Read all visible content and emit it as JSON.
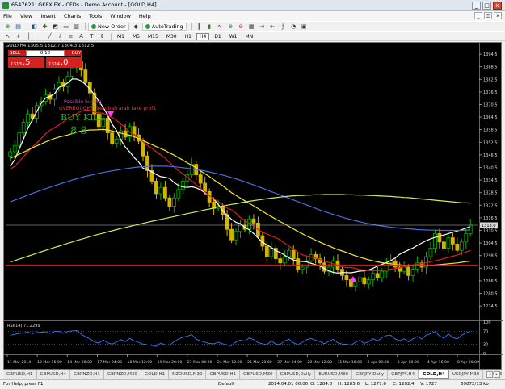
{
  "window": {
    "title": "6547621: GKFX FX - CFDs - Demo Account - [GOLD,H4]",
    "buttons": [
      "_",
      "□",
      "x"
    ]
  },
  "menu": {
    "items": [
      "File",
      "View",
      "Insert",
      "Charts",
      "Tools",
      "Window",
      "Help"
    ]
  },
  "toolbar": {
    "new_order": "New Order",
    "autotrading": "AutoTrading",
    "timeframes": [
      "M1",
      "M5",
      "M15",
      "M30",
      "H1",
      "H4",
      "D1",
      "W1",
      "MN"
    ],
    "active_timeframe": "H4"
  },
  "chart_window": {
    "title": "GOLD,H4  1305.5 1312.7 1304.3 1312.5"
  },
  "one_click": {
    "sell_label": "SELL",
    "buy_label": "BUY",
    "volume": "0.10",
    "sell_small": "1313",
    "sell_big": ".5",
    "buy_small": "1314",
    "buy_big": ".0"
  },
  "annotations": {
    "lines": [
      "Possible buying",
      "OVERBOUGHT! berubah arah take profit"
    ],
    "signal": "BUY KILL",
    "digits": "8  8"
  },
  "rsi": {
    "label": "RSI(14) 71.2299"
  },
  "chart_data": {
    "type": "candlestick",
    "symbol": "GOLD",
    "timeframe": "H4",
    "ylim": [
      1268,
      1398
    ],
    "price_ticks": [
      1394.5,
      1388.5,
      1382.5,
      1376.5,
      1370.5,
      1364.5,
      1358.5,
      1352.5,
      1346.5,
      1340.5,
      1334.5,
      1328.5,
      1322.5,
      1316.5,
      1310.5,
      1304.5,
      1298.5,
      1292.5,
      1286.5,
      1280.5,
      1274.5
    ],
    "current_price": "1313.0",
    "current_price_value": 1313.0,
    "horizontal_lines": [
      1313.0,
      1294.0
    ],
    "x_ticks": [
      "11 Mar 2014",
      "12 Mar 16:00",
      "14 Mar 00:00",
      "17 Mar 04:00",
      "18 Mar 12:00",
      "19 Mar 20:00",
      "21 Mar 04:00",
      "24 Mar 12:00",
      "25 Mar 20:00",
      "27 Mar 04:00",
      "28 Mar 12:00",
      "31 Mar 16:00",
      "2 Apr 00:00",
      "3 Apr 08:00",
      "4 Apr 16:00",
      "8 Apr 00:00"
    ],
    "close": [
      1348,
      1351,
      1357,
      1362,
      1366,
      1364,
      1370,
      1372,
      1375,
      1373,
      1378,
      1381,
      1379,
      1384,
      1388,
      1391,
      1387,
      1381,
      1376,
      1366,
      1360,
      1364,
      1357,
      1352,
      1354,
      1358,
      1355,
      1360,
      1356,
      1353,
      1346,
      1339,
      1334,
      1328,
      1331,
      1326,
      1322,
      1326,
      1330,
      1334,
      1337,
      1342,
      1337,
      1333,
      1329,
      1324,
      1321,
      1322,
      1318,
      1311,
      1306,
      1310,
      1313,
      1311,
      1316,
      1314,
      1308,
      1303,
      1298,
      1302,
      1297,
      1295,
      1298,
      1301,
      1297,
      1292,
      1293,
      1296,
      1299,
      1297,
      1295,
      1291,
      1293,
      1296,
      1292,
      1289,
      1287,
      1284,
      1286,
      1288,
      1285,
      1287,
      1290,
      1288,
      1291,
      1295,
      1296,
      1293,
      1291,
      1293,
      1289,
      1292,
      1295,
      1293,
      1298,
      1302,
      1309,
      1305,
      1302,
      1307,
      1304,
      1301,
      1305,
      1309,
      1313
    ],
    "series": [
      {
        "name": "white",
        "color": "#ffffff",
        "values": [
          1341.0,
          1344.2,
          1349.2,
          1354.2,
          1359.2,
          1363.2,
          1367.2,
          1371.1,
          1373.6,
          1374.4,
          1375.7,
          1378.7,
          1379.6,
          1380.8,
          1382.7,
          1382.6,
          1381.8,
          1380.1,
          1377.9,
          1375.2,
          1372.1,
          1369.1,
          1365.5,
          1361.1,
          1358.1,
          1353.6,
          1350.2,
          1347.9,
          1345.2,
          1343.2,
          1340.1,
          1339.5,
          1338.4,
          1337.1,
          1336.1,
          1335.8,
          1335.3,
          1333.3,
          1332.0,
          1331.2,
          1331.0,
          1331.3,
          1330.8,
          1329.8,
          1328.4,
          1327.0,
          1325.4,
          1322.9,
          1320.0,
          1317.6,
          1315.8,
          1314.4,
          1313.7,
          1312.0,
          1310.8,
          1309.0,
          1306.9,
          1304.8,
          1303.6,
          1302.4,
          1300.9,
          1300.0,
          1298.7,
          1297.4,
          1296.4,
          1295.9,
          1295.7,
          1295.5,
          1294.8,
          1294.2,
          1293.5,
          1292.3,
          1291.2,
          1290.5,
          1290.2,
          1290.4,
          1290.4,
          1290.3,
          1290.7,
          1291.1,
          1291.2,
          1291.6,
          1292.5,
          1293.5,
          1294.3,
          1295.1,
          1296.1,
          1297.4,
          1299.1,
          1300.2,
          1301.2,
          1302.1,
          1303.4,
          1304.5,
          1305.6,
          1306.5,
          1307.2,
          1307.8,
          1308.3,
          1309.0,
          1309.6,
          1310.2,
          1310.8,
          1311.6,
          1312.3
        ]
      },
      {
        "name": "red",
        "color": "#dd1e1e",
        "values": [
          1339.8,
          1341.0,
          1343.3,
          1345.7,
          1348.1,
          1350.3,
          1352.2,
          1354.4,
          1356.6,
          1358.3,
          1359.5,
          1360.8,
          1362.2,
          1363.8,
          1364.9,
          1366.1,
          1367.3,
          1367.8,
          1367.8,
          1366.9,
          1366.5,
          1366.4,
          1365.4,
          1364.3,
          1363.0,
          1361.1,
          1359.5,
          1357.4,
          1356.2,
          1354.6,
          1352.8,
          1350.9,
          1349.6,
          1348.0,
          1346.5,
          1345.0,
          1342.9,
          1340.8,
          1338.9,
          1337.5,
          1335.8,
          1334.1,
          1332.3,
          1330.6,
          1328.8,
          1327.0,
          1325.5,
          1324.3,
          1322.6,
          1321.2,
          1320.3,
          1318.7,
          1316.6,
          1315.2,
          1313.9,
          1312.5,
          1311.0,
          1309.6,
          1308.8,
          1307.9,
          1307.0,
          1306.0,
          1304.4,
          1303.0,
          1301.6,
          1300.2,
          1298.9,
          1298.3,
          1297.8,
          1297.3,
          1296.6,
          1295.8,
          1295.2,
          1294.6,
          1293.9,
          1293.1,
          1292.8,
          1292.8,
          1292.4,
          1291.8,
          1291.6,
          1291.3,
          1291.3,
          1291.3,
          1291.3,
          1291.6,
          1292.0,
          1292.3,
          1292.6,
          1293.1,
          1293.6,
          1294.0,
          1294.4,
          1294.7,
          1295.1,
          1295.6,
          1296.0,
          1296.5,
          1297.1,
          1297.6,
          1298.2,
          1298.8,
          1299.5,
          1300.2,
          1301.0
        ]
      },
      {
        "name": "yellow",
        "color": "#f2e830",
        "values": [
          1344.9,
          1345.8,
          1346.8,
          1347.8,
          1348.8,
          1349.9,
          1350.8,
          1351.7,
          1352.7,
          1353.5,
          1354.3,
          1355.0,
          1355.5,
          1356.0,
          1356.6,
          1357.3,
          1357.8,
          1358.1,
          1358.4,
          1358.4,
          1358.5,
          1358.6,
          1358.4,
          1357.9,
          1357.4,
          1356.9,
          1356.3,
          1355.9,
          1355.1,
          1354.4,
          1353.4,
          1352.3,
          1351.4,
          1350.4,
          1349.5,
          1348.6,
          1347.4,
          1346.4,
          1345.2,
          1344.0,
          1342.7,
          1341.6,
          1340.3,
          1338.8,
          1337.5,
          1336.1,
          1334.6,
          1333.2,
          1331.8,
          1330.1,
          1328.5,
          1327.2,
          1325.9,
          1324.6,
          1323.4,
          1322.2,
          1320.9,
          1319.6,
          1318.3,
          1317.1,
          1315.9,
          1314.7,
          1313.6,
          1312.4,
          1311.2,
          1310.0,
          1308.9,
          1307.8,
          1306.9,
          1305.9,
          1304.9,
          1304.0,
          1303.1,
          1302.2,
          1301.4,
          1300.7,
          1300.0,
          1299.2,
          1298.4,
          1297.7,
          1297.1,
          1296.5,
          1296.0,
          1295.5,
          1295.1,
          1294.8,
          1294.6,
          1294.3,
          1294.1,
          1293.9,
          1293.8,
          1293.7,
          1293.7,
          1293.7,
          1293.7,
          1293.8,
          1294.0,
          1294.2,
          1294.4,
          1294.6,
          1294.8,
          1295.0,
          1295.3,
          1295.6,
          1295.9
        ]
      },
      {
        "name": "blue",
        "color": "#4a6fe0",
        "values": [
          1324.1,
          1324.9,
          1325.7,
          1326.5,
          1327.4,
          1328.1,
          1328.9,
          1329.7,
          1330.4,
          1331.1,
          1331.8,
          1332.5,
          1333.2,
          1333.8,
          1334.5,
          1335.1,
          1335.7,
          1336.3,
          1336.7,
          1337.2,
          1337.7,
          1338.1,
          1338.5,
          1338.9,
          1339.2,
          1339.6,
          1339.9,
          1340.2,
          1340.5,
          1340.7,
          1340.8,
          1341.0,
          1341.1,
          1341.1,
          1341.1,
          1341.1,
          1341.0,
          1340.8,
          1340.6,
          1340.4,
          1340.1,
          1339.8,
          1339.5,
          1339.2,
          1338.8,
          1338.4,
          1337.9,
          1337.4,
          1336.9,
          1336.3,
          1335.7,
          1335.1,
          1334.4,
          1333.7,
          1332.9,
          1332.2,
          1331.4,
          1330.6,
          1329.8,
          1329.0,
          1328.2,
          1327.4,
          1326.6,
          1325.8,
          1325.0,
          1324.2,
          1323.4,
          1322.6,
          1321.8,
          1321.0,
          1320.2,
          1319.5,
          1318.8,
          1318.1,
          1317.5,
          1316.8,
          1316.2,
          1315.7,
          1315.1,
          1314.6,
          1314.1,
          1313.7,
          1313.3,
          1312.9,
          1312.6,
          1312.3,
          1312.0,
          1311.8,
          1311.6,
          1311.4,
          1311.2,
          1311.1,
          1310.9,
          1310.8,
          1310.7,
          1310.6,
          1310.6,
          1310.5,
          1310.5,
          1310.5,
          1310.5,
          1310.5,
          1310.5,
          1310.6,
          1310.7
        ]
      },
      {
        "name": "green",
        "color": "#c8f05a",
        "values": [
          1295.4,
          1296.1,
          1296.8,
          1297.5,
          1298.2,
          1298.9,
          1299.6,
          1300.3,
          1301.0,
          1301.7,
          1302.4,
          1303.0,
          1303.7,
          1304.4,
          1305.0,
          1305.7,
          1306.3,
          1306.9,
          1307.5,
          1308.1,
          1308.7,
          1309.2,
          1309.8,
          1310.3,
          1310.9,
          1311.4,
          1311.9,
          1312.4,
          1312.9,
          1313.4,
          1313.9,
          1314.4,
          1314.9,
          1315.3,
          1315.8,
          1316.2,
          1316.7,
          1317.1,
          1317.6,
          1318.0,
          1318.5,
          1318.9,
          1319.4,
          1319.8,
          1320.3,
          1320.7,
          1321.2,
          1321.6,
          1322.1,
          1322.5,
          1322.9,
          1323.2,
          1323.6,
          1324.0,
          1324.4,
          1324.7,
          1325.0,
          1325.3,
          1325.6,
          1325.9,
          1326.1,
          1326.4,
          1326.6,
          1326.8,
          1327.0,
          1327.1,
          1327.2,
          1327.3,
          1327.4,
          1327.5,
          1327.5,
          1327.6,
          1327.6,
          1327.6,
          1327.6,
          1327.6,
          1327.5,
          1327.5,
          1327.4,
          1327.4,
          1327.3,
          1327.2,
          1327.1,
          1327.0,
          1326.9,
          1326.8,
          1326.7,
          1326.5,
          1326.4,
          1326.2,
          1326.1,
          1325.9,
          1325.7,
          1325.5,
          1325.3,
          1325.1,
          1324.9,
          1324.7,
          1324.5,
          1324.3,
          1324.1,
          1323.9,
          1323.7,
          1323.6,
          1323.5
        ]
      }
    ],
    "rsi_ylim": [
      0,
      100
    ],
    "rsi_ticks": [
      100,
      70,
      30,
      0
    ],
    "rsi_values": [
      58,
      61,
      64,
      66,
      68,
      63,
      67,
      68,
      69,
      64,
      70,
      71,
      64,
      70,
      72,
      73,
      62,
      53,
      47,
      37,
      33,
      43,
      34,
      30,
      36,
      44,
      38,
      48,
      40,
      36,
      30,
      27,
      26,
      23,
      33,
      28,
      26,
      38,
      46,
      52,
      55,
      60,
      46,
      40,
      36,
      32,
      31,
      36,
      31,
      27,
      25,
      37,
      43,
      39,
      50,
      44,
      35,
      31,
      28,
      40,
      30,
      29,
      40,
      46,
      34,
      28,
      36,
      44,
      48,
      42,
      38,
      31,
      39,
      45,
      34,
      30,
      29,
      26,
      36,
      42,
      32,
      38,
      47,
      40,
      50,
      57,
      58,
      46,
      41,
      47,
      37,
      47,
      54,
      46,
      59,
      63,
      70,
      56,
      49,
      62,
      51,
      46,
      58,
      66,
      71
    ],
    "grid": false,
    "colors": {
      "background": "#000000",
      "bull": "#00b400",
      "bear": "#d2b400",
      "text": "#ffffff"
    }
  },
  "symbol_tabs": [
    "GBPUSD,H1",
    "GBPUSD,H4",
    "GBPNZD,H1",
    "GBPNZD,M30",
    "GOLD,H1",
    "NZDUSD,M30",
    "GBPUSD,H1",
    "GBPUSD,M30",
    "GBPUSD,Daily",
    "EURUSD,M30",
    "GBPJPY,Daily",
    "GBPJPY,H4",
    "GOLD,H4",
    "USDJPY,M30",
    "AUDUSD,M30",
    "US"
  ],
  "active_tab": "GOLD,H4",
  "statusbar": {
    "help": "For Help, press F1",
    "profile": "Default",
    "datetime": "2014.04.01 00:00",
    "open": "O: 1284.8",
    "high": "H: 1285.6",
    "low": "L: 1277.6",
    "close": "C: 1282.4",
    "volume": "V: 1727",
    "traffic": "69872/13 kb"
  }
}
